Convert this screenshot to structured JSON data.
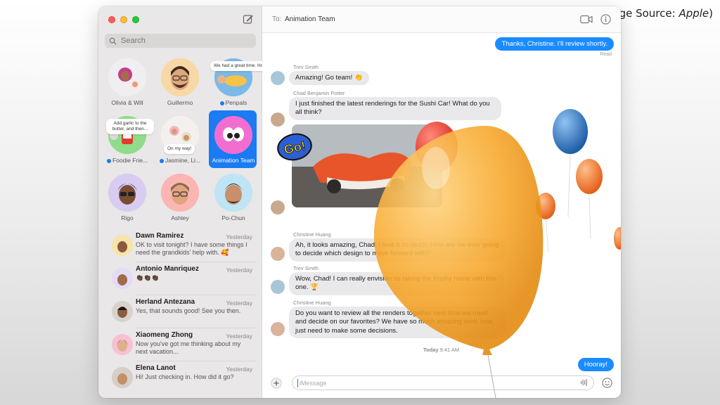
{
  "caption": {
    "prefix": "(Image Source: ",
    "source": "Apple",
    "suffix": ")"
  },
  "sidebar": {
    "search_placeholder": "Search",
    "pinned": [
      {
        "label": "Olivia & Will"
      },
      {
        "label": "Guillermo"
      },
      {
        "label": "Penpals",
        "unread": true,
        "tip": "We had a great time. Home with..."
      },
      {
        "label": "Foodie Frie...",
        "unread": true,
        "tip": "Add garlic to the butter, and then..."
      },
      {
        "label": "Jasmine, Li...",
        "unread": true,
        "tip": "On my way!"
      },
      {
        "label": "Animation Team",
        "selected": true
      },
      {
        "label": "Rigo"
      },
      {
        "label": "Ashley"
      },
      {
        "label": "Po-Chun"
      }
    ],
    "conversations": [
      {
        "name": "Dawn Ramirez",
        "time": "Yesterday",
        "preview": "OK to visit tonight? I have some things I need the grandkids' help with. 🥰"
      },
      {
        "name": "Antonio Manriquez",
        "time": "Yesterday",
        "preview": "👏🏿👏🏿👏🏿"
      },
      {
        "name": "Herland Antezana",
        "time": "Yesterday",
        "preview": "Yes, that sounds good! See you then."
      },
      {
        "name": "Xiaomeng Zhong",
        "time": "Yesterday",
        "preview": "Now you've got me thinking about my next vacation..."
      },
      {
        "name": "Elena Lanot",
        "time": "Yesterday",
        "preview": "Hi! Just checking in. How did it go?"
      }
    ]
  },
  "chat": {
    "to_label": "To:",
    "recipient": "Animation Team",
    "messages": {
      "m1": "Thanks, Christine. I'll review shortly.",
      "read": "Read",
      "s1": "Trev Smith",
      "m2": "Amazing! Go team! 👏",
      "s2": "Chad Benjamin Potter",
      "m3": "I just finished the latest renderings for the Sushi Car! What do you all think?",
      "sticker_go": "Go!",
      "s3": "Christine Huang",
      "m4": "Ah, it looks amazing, Chad! I love it so much. How are we ever going to decide which design to move forward with?",
      "s4": "Trev Smith",
      "m5": "Wow, Chad! I can really envision us taking the trophy home with this one. 🏆",
      "s5": "Christine Huang",
      "m6": "Do you want to review all the renders together next time we meet and decide on our favorites? We have so much amazing work now, just need to make some decisions.",
      "ts_day": "Today",
      "ts_time": "9:41 AM",
      "m7": "Hooray!"
    },
    "compose_placeholder": "iMessage"
  },
  "colors": {
    "accent": "#1a7bf2",
    "sent_bubble": "#1a8cff",
    "recv_bubble": "#e9e9eb"
  }
}
